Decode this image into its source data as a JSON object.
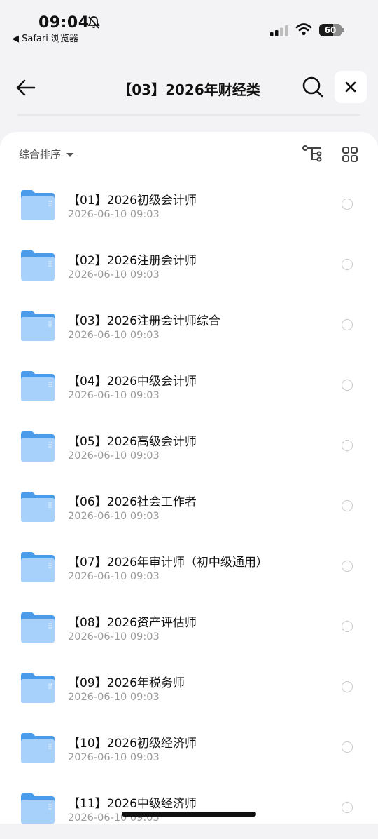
{
  "status_bar": {
    "time": "09:04",
    "back_app": "◀ Safari 浏览器",
    "battery": "60"
  },
  "header": {
    "title": "【03】2026年财经类"
  },
  "toolbar": {
    "sort_label": "综合排序"
  },
  "colors": {
    "folder_top": "#4a9bea",
    "folder_body": "#a7d1fb",
    "accent_bg": "#f3f3f5"
  },
  "items": [
    {
      "name": "【01】2026初级会计师",
      "date": "2026-06-10 09:03"
    },
    {
      "name": "【02】2026注册会计师",
      "date": "2026-06-10 09:03"
    },
    {
      "name": "【03】2026注册会计师综合",
      "date": "2026-06-10 09:03"
    },
    {
      "name": "【04】2026中级会计师",
      "date": "2026-06-10 09:03"
    },
    {
      "name": "【05】2026高级会计师",
      "date": "2026-06-10 09:03"
    },
    {
      "name": "【06】2026社会工作者",
      "date": "2026-06-10 09:03"
    },
    {
      "name": "【07】2026年审计师（初中级通用）",
      "date": "2026-06-10 09:03"
    },
    {
      "name": "【08】2026资产评估师",
      "date": "2026-06-10 09:03"
    },
    {
      "name": "【09】2026年税务师",
      "date": "2026-06-10 09:03"
    },
    {
      "name": "【10】2026初级经济师",
      "date": "2026-06-10 09:03"
    },
    {
      "name": "【11】2026中级经济师",
      "date": "2026-06-10 09:03"
    }
  ]
}
